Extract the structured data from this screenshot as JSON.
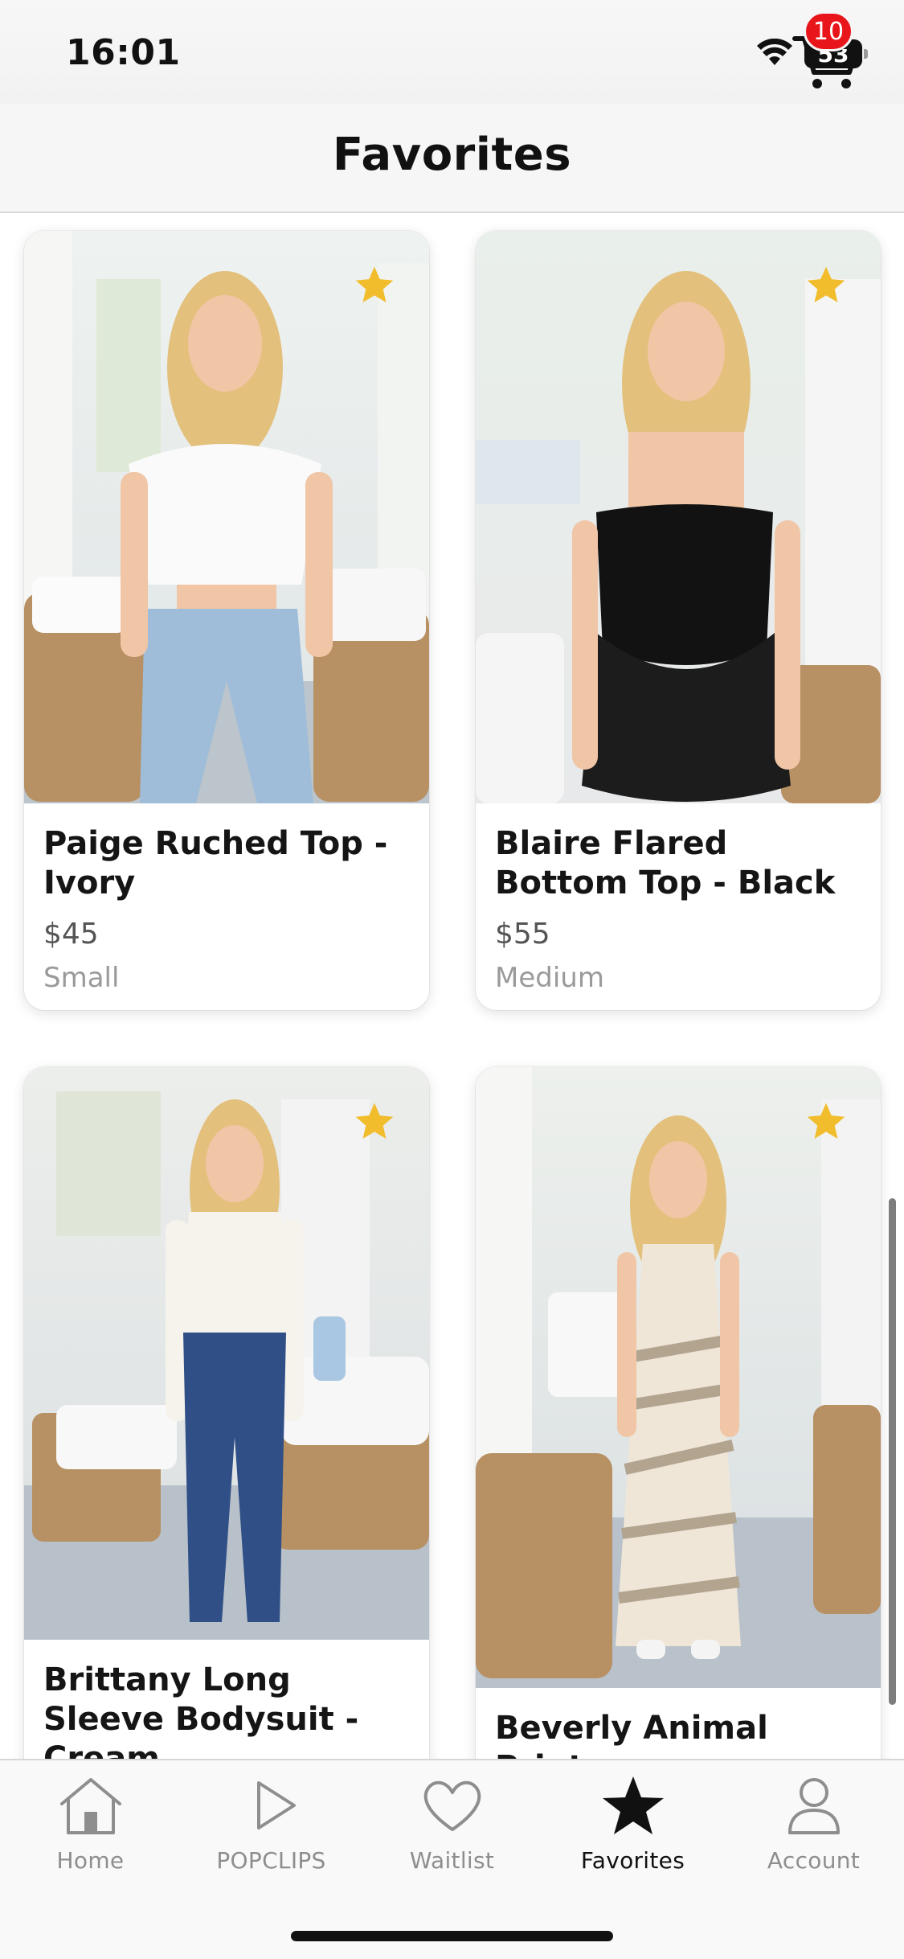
{
  "status_bar": {
    "time": "16:01",
    "battery": "53"
  },
  "header": {
    "title": "Favorites",
    "cart_count": "10"
  },
  "products": [
    {
      "name": "Paige Ruched Top - Ivory",
      "price": "$45",
      "size": "Small"
    },
    {
      "name": "Blaire Flared Bottom Top - Black",
      "price": "$55",
      "size": "Medium"
    },
    {
      "name": "Brittany Long Sleeve Bodysuit - Cream",
      "price": "",
      "size": ""
    },
    {
      "name": "Beverly Animal Print",
      "price": "",
      "size": ""
    }
  ],
  "tabs": [
    {
      "label": "Home",
      "icon": "home-icon"
    },
    {
      "label": "POPCLIPS",
      "icon": "play-icon"
    },
    {
      "label": "Waitlist",
      "icon": "heart-icon"
    },
    {
      "label": "Favorites",
      "icon": "star-icon",
      "active": true
    },
    {
      "label": "Account",
      "icon": "person-icon"
    }
  ],
  "colors": {
    "favorite_star": "#f2bd2c",
    "badge": "#e8161b",
    "active_tab": "#111111",
    "inactive_tab": "#8e8e8e"
  }
}
